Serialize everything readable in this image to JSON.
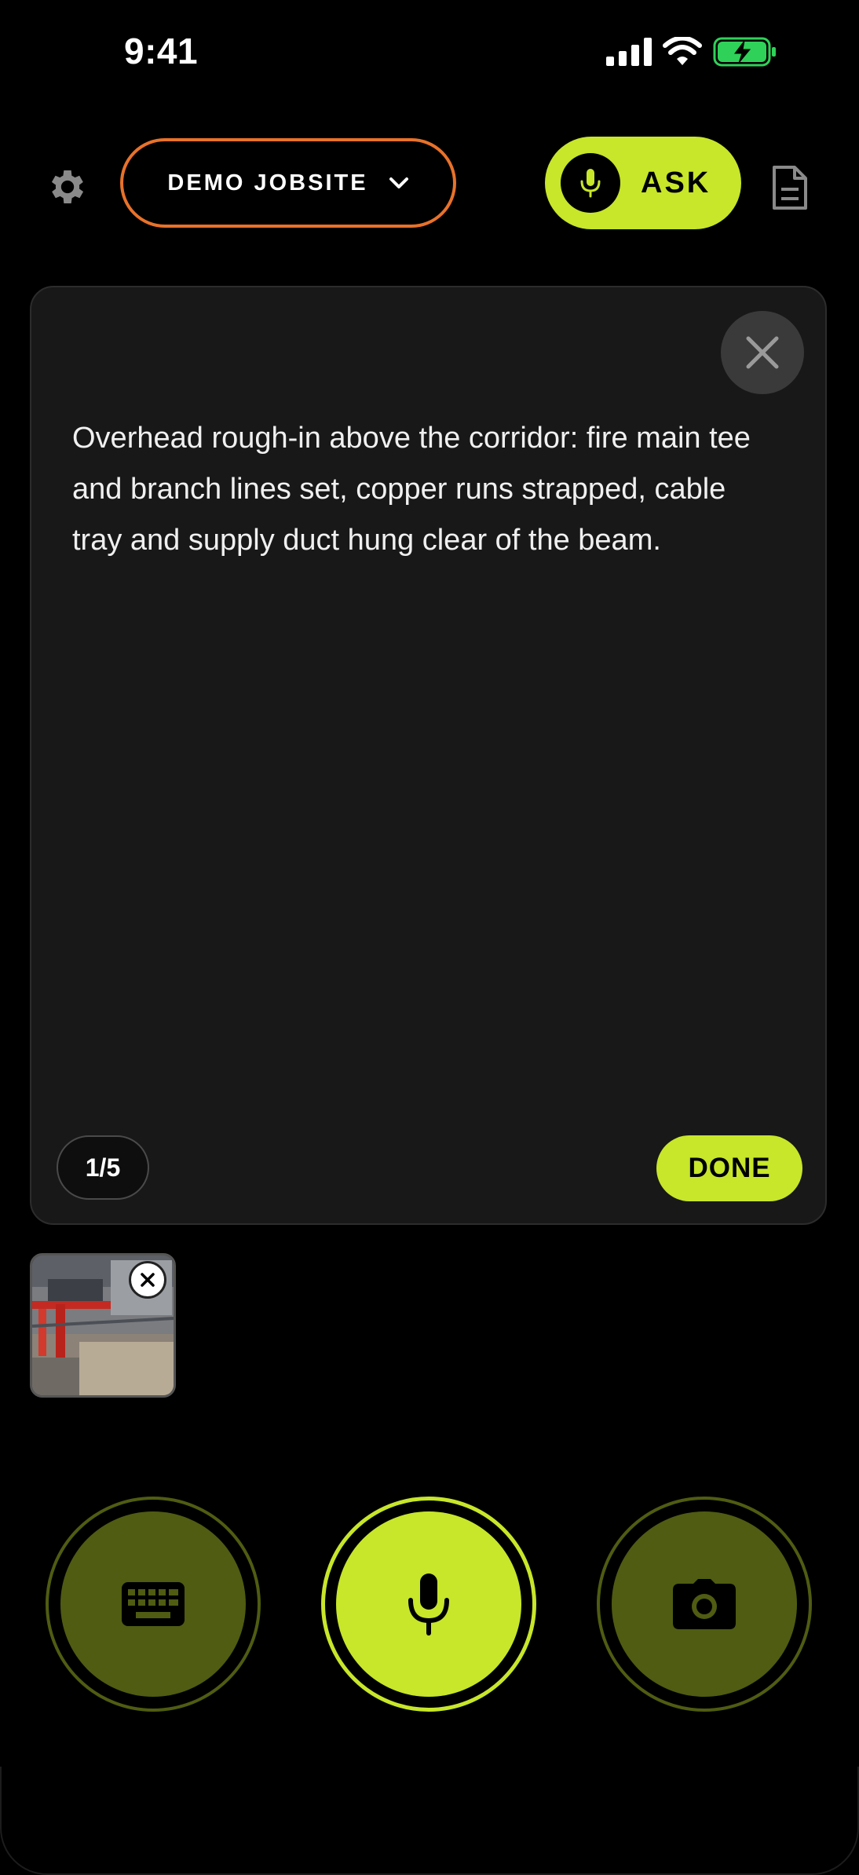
{
  "status_bar": {
    "time": "9:41"
  },
  "header": {
    "site_name": "DEMO JOBSITE",
    "ask_label": "ASK"
  },
  "card": {
    "text": "Overhead rough-in above the corridor: fire main tee and branch lines set, copper runs strapped, cable tray and supply duct hung clear of the beam.",
    "page_indicator": "1/5",
    "done_label": "DONE"
  },
  "colors": {
    "accent": "#c8e62a",
    "accent_dim": "#4f5c12",
    "site_border": "#e8722a",
    "card_bg": "#181818",
    "background": "#000000"
  },
  "icons": {
    "settings": "gear-icon",
    "site_dropdown": "chevron-down-icon",
    "ask_mic": "microphone-icon",
    "notes": "document-icon",
    "card_close": "close-icon",
    "thumb_remove": "close-icon",
    "keyboard": "keyboard-icon",
    "record": "microphone-icon",
    "camera": "camera-icon"
  }
}
